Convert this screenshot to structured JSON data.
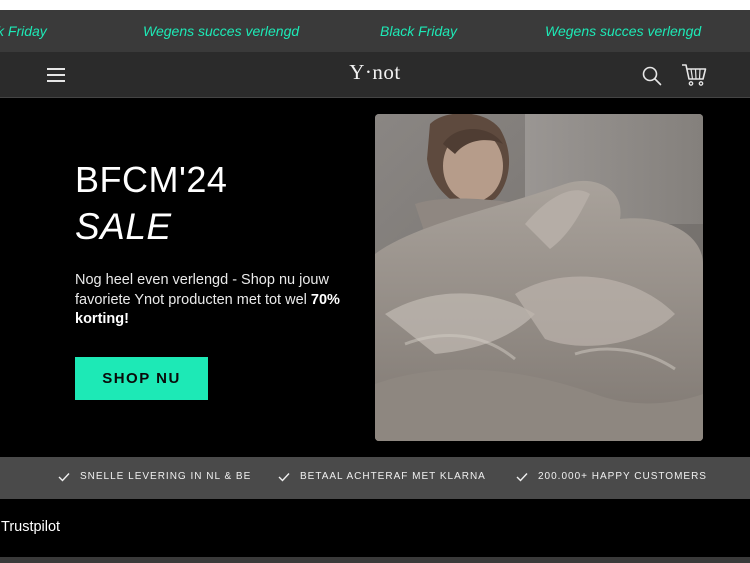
{
  "announcement": {
    "items": [
      "ck Friday",
      "Wegens succes verlengd",
      "Black Friday",
      "Wegens succes verlengd"
    ]
  },
  "header": {
    "logo": "Y·not",
    "logo_tagline": "",
    "icons": [
      "menu-icon",
      "search-icon",
      "cart-icon"
    ]
  },
  "hero": {
    "title": "BFCM'24",
    "subtitle": "SALE",
    "text_before": "Nog heel even verlengd - Shop nu jouw favoriete Ynot producten met tot wel ",
    "text_bold": "70% korting!",
    "button_label": "SHOP NU"
  },
  "usps": [
    "SNELLE LEVERING IN NL & BE",
    "BETAAL ACHTERAF MET KLARNA",
    "200.000+ HAPPY CUSTOMERS"
  ],
  "trustpilot": {
    "label": "Trustpilot"
  },
  "colors": {
    "accent": "#1de9b6",
    "marquee_bg": "#3a3a3a",
    "header_bg": "#2b2b2b",
    "usp_bg": "#4a4a4a"
  }
}
